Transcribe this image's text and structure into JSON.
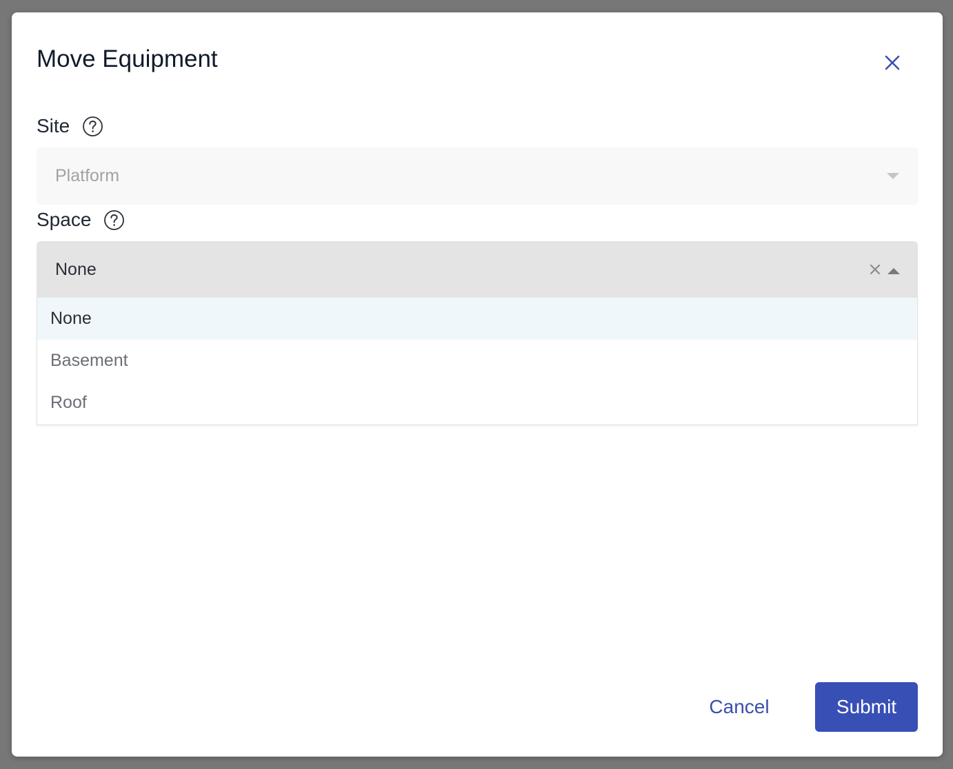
{
  "dialog": {
    "title": "Move Equipment",
    "close_icon": "close-icon"
  },
  "site": {
    "label": "Site",
    "help_icon": "help-circle-icon",
    "value": "Platform",
    "disabled": true
  },
  "space": {
    "label": "Space",
    "help_icon": "help-circle-icon",
    "value": "None",
    "open": true,
    "options": [
      {
        "label": "None",
        "highlighted": true
      },
      {
        "label": "Basement",
        "highlighted": false
      },
      {
        "label": "Roof",
        "highlighted": false
      }
    ]
  },
  "actions": {
    "cancel_label": "Cancel",
    "submit_label": "Submit"
  },
  "colors": {
    "accent": "#3850b5",
    "link": "#3a4fad",
    "backdrop": "#777777",
    "highlight": "#f0f7fb"
  }
}
